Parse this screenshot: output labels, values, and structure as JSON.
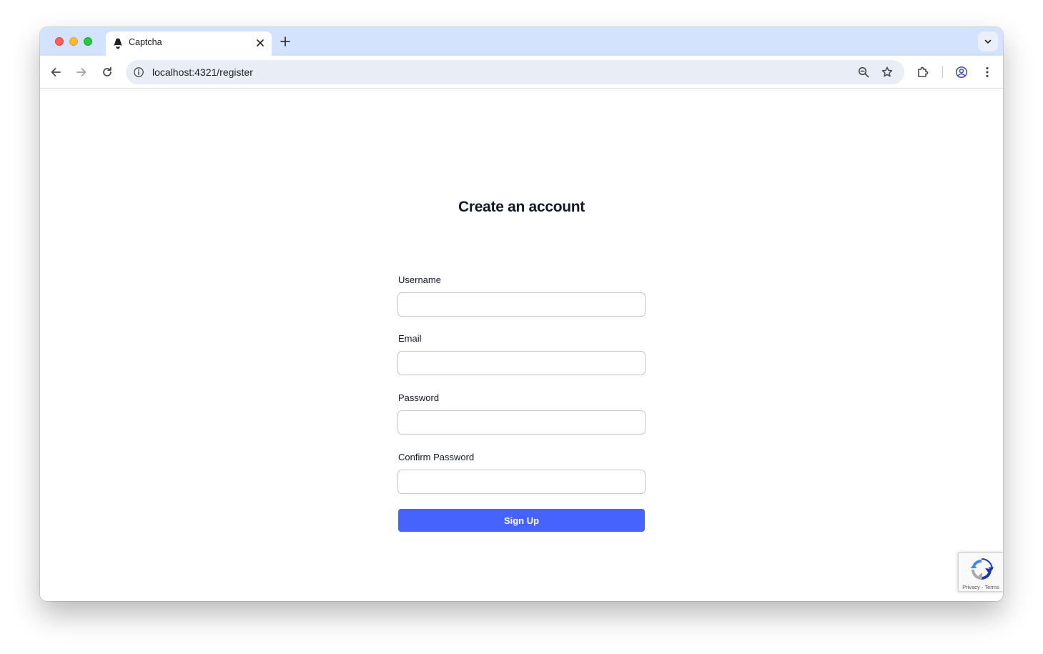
{
  "browser": {
    "tab_title": "Captcha",
    "url": "localhost:4321/register"
  },
  "form": {
    "heading": "Create an account",
    "fields": [
      {
        "label": "Username",
        "value": ""
      },
      {
        "label": "Email",
        "value": ""
      },
      {
        "label": "Password",
        "value": ""
      },
      {
        "label": "Confirm Password",
        "value": ""
      }
    ],
    "submit_label": "Sign Up"
  },
  "recaptcha": {
    "privacy": "Privacy",
    "separator": " - ",
    "terms": "Terms"
  },
  "colors": {
    "accent": "#4763fe",
    "tabstrip": "#d3e3fd",
    "omnibox": "#e9eef6"
  },
  "icons": {
    "favicon": "astro-logo-icon",
    "back": "arrow-left-icon",
    "forward": "arrow-right-icon",
    "reload": "reload-icon",
    "site_info": "info-icon",
    "zoom": "zoom-out-icon",
    "bookmark": "star-icon",
    "extensions": "puzzle-icon",
    "profile": "profile-icon",
    "menu": "kebab-menu-icon"
  }
}
